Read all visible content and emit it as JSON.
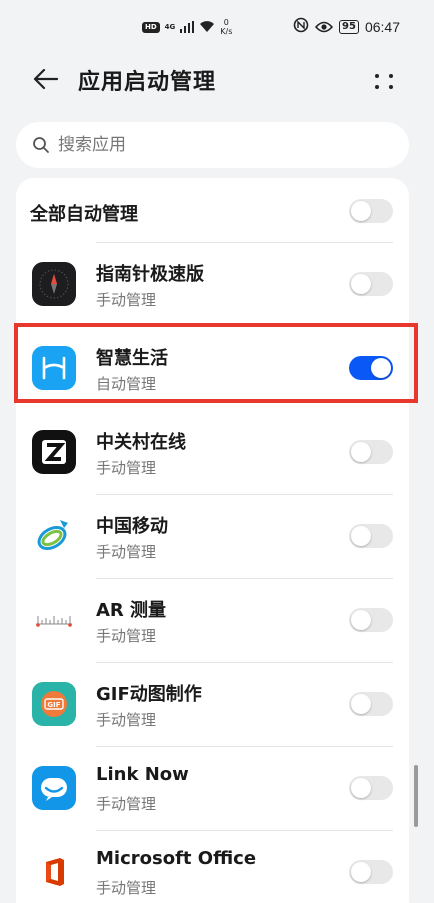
{
  "status_bar": {
    "hd": "HD",
    "network": "4G",
    "speed_value": "0",
    "speed_unit": "K/s",
    "battery": "95",
    "time": "06:47"
  },
  "header": {
    "title": "应用启动管理"
  },
  "search": {
    "placeholder": "搜索应用"
  },
  "all_auto": {
    "label": "全部自动管理",
    "enabled": false
  },
  "apps": [
    {
      "name": "指南针极速版",
      "status": "手动管理",
      "enabled": false,
      "icon": "compass-app-icon"
    },
    {
      "name": "智慧生活",
      "status": "自动管理",
      "enabled": true,
      "icon": "smart-life-app-icon"
    },
    {
      "name": "中关村在线",
      "status": "手动管理",
      "enabled": false,
      "icon": "zol-app-icon"
    },
    {
      "name": "中国移动",
      "status": "手动管理",
      "enabled": false,
      "icon": "china-mobile-app-icon"
    },
    {
      "name": "AR 测量",
      "status": "手动管理",
      "enabled": false,
      "icon": "ar-measure-app-icon"
    },
    {
      "name": "GIF动图制作",
      "status": "手动管理",
      "enabled": false,
      "icon": "gif-maker-app-icon"
    },
    {
      "name": "Link Now",
      "status": "手动管理",
      "enabled": false,
      "icon": "link-now-app-icon"
    },
    {
      "name": "Microsoft Office",
      "status": "手动管理",
      "enabled": false,
      "icon": "office-app-icon"
    }
  ],
  "colors": {
    "toggle_on": "#0a59f7",
    "highlight_border": "#e8382d",
    "background": "#f1f3f5"
  }
}
